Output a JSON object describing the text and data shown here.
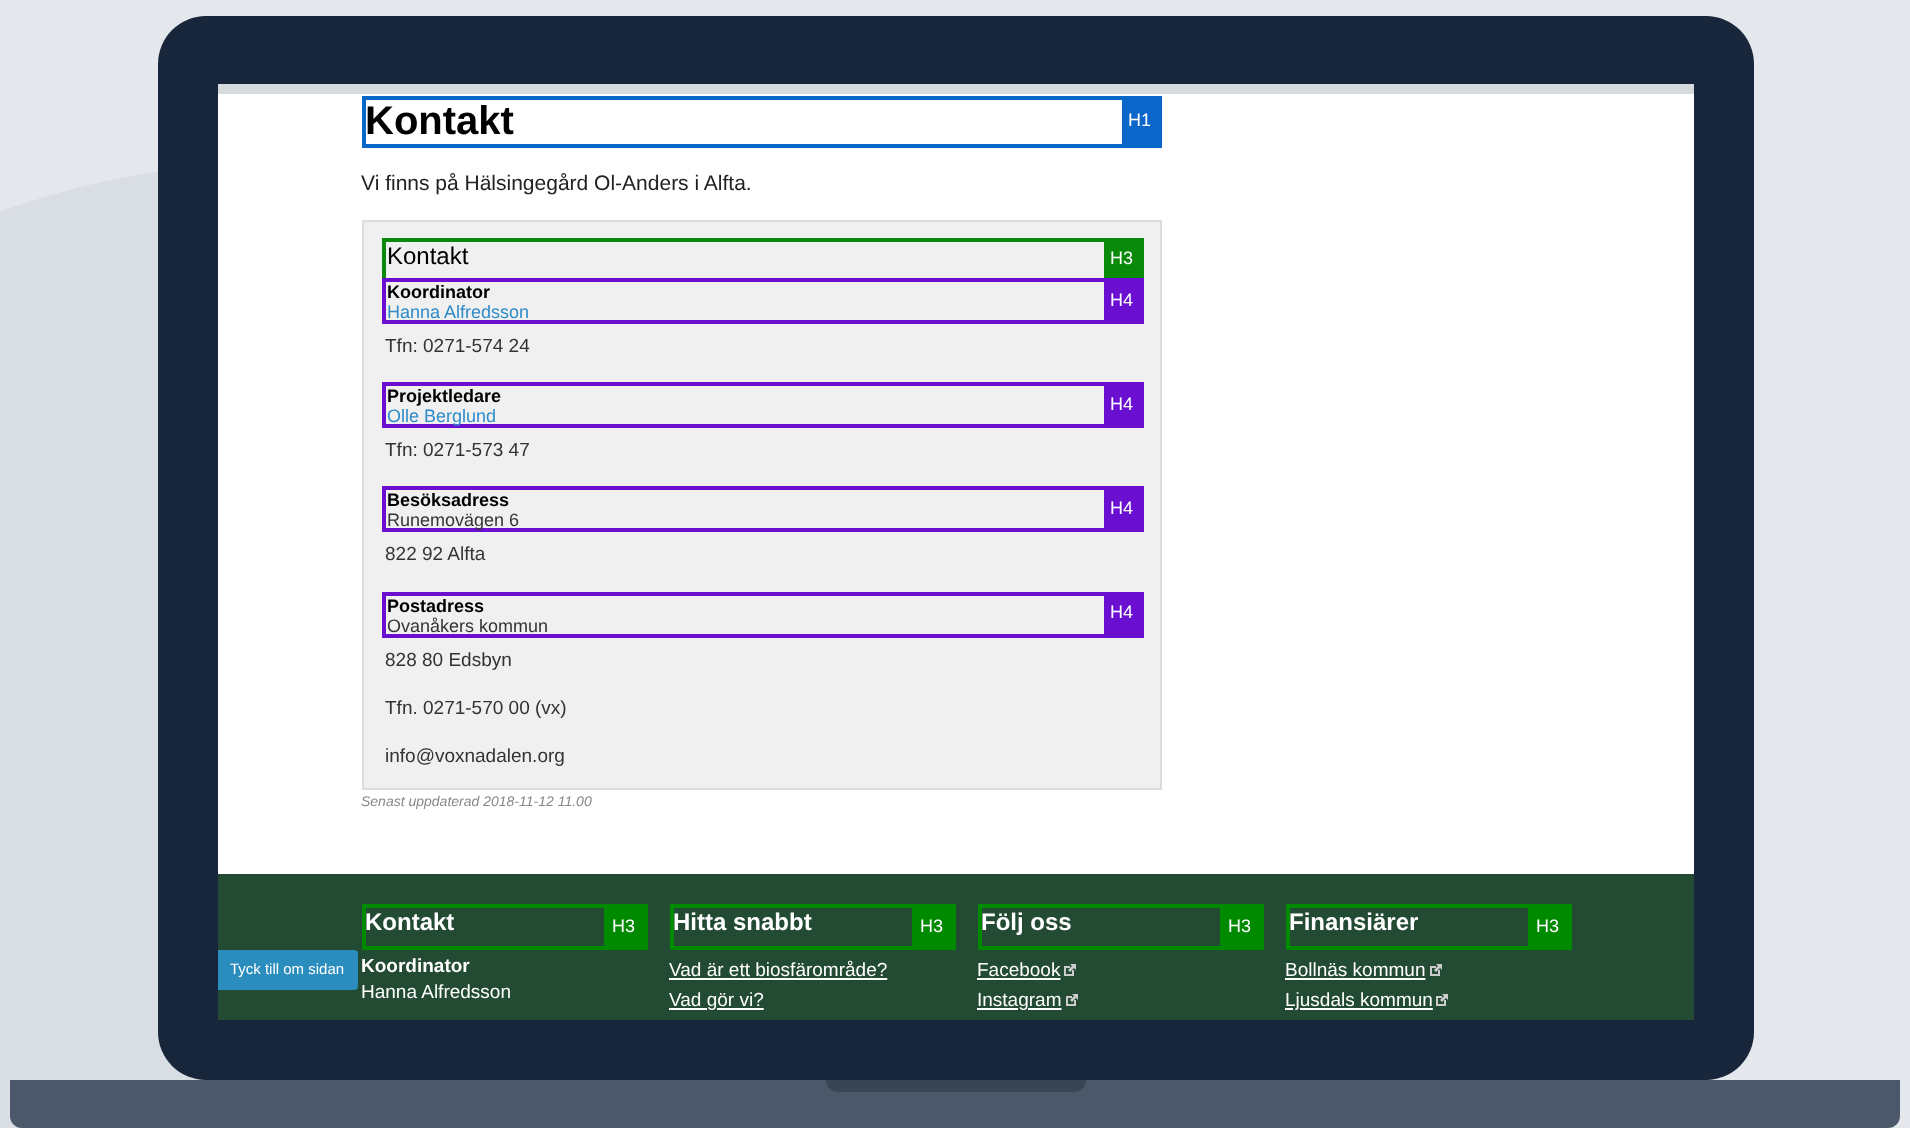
{
  "page_heading": {
    "text": "Kontakt",
    "badge": "H1"
  },
  "intro": "Vi finns på Hälsingegård Ol-Anders i Alfta.",
  "contact_box": {
    "heading": {
      "text": "Kontakt",
      "badge": "H3"
    },
    "sections": [
      {
        "title": "Koordinator",
        "badge": "H4",
        "first_line": {
          "text": "Hanna Alfredsson",
          "link": true
        },
        "lines": [
          "Tfn: 0271-574 24"
        ]
      },
      {
        "title": "Projektledare",
        "badge": "H4",
        "first_line": {
          "text": "Olle Berglund",
          "link": true
        },
        "lines": [
          "Tfn: 0271-573 47"
        ]
      },
      {
        "title": "Besöksadress",
        "badge": "H4",
        "first_line": {
          "text": "Runemovägen 6",
          "link": false
        },
        "lines": [
          "822 92 Alfta"
        ]
      },
      {
        "title": "Postadress",
        "badge": "H4",
        "first_line": {
          "text": "Ovanåkers kommun",
          "link": false
        },
        "lines": [
          "828 80 Edsbyn"
        ]
      }
    ],
    "extra_lines": [
      "Tfn. 0271-570 00 (vx)",
      "info@voxnadalen.org"
    ]
  },
  "updated": "Senast uppdaterad 2018-11-12 11.00",
  "feedback_button": "Tyck till om sidan",
  "footer_columns": [
    {
      "heading": "Kontakt",
      "badge": "H3",
      "items": [
        {
          "text": "Koordinator",
          "kind": "label",
          "external": false
        },
        {
          "text": "Hanna Alfredsson",
          "kind": "text",
          "external": false
        }
      ]
    },
    {
      "heading": "Hitta snabbt",
      "badge": "H3",
      "items": [
        {
          "text": "Vad är ett biosfärområde?",
          "kind": "link",
          "external": false
        },
        {
          "text": "Vad gör vi?",
          "kind": "link",
          "external": false
        }
      ]
    },
    {
      "heading": "Följ oss",
      "badge": "H3",
      "items": [
        {
          "text": "Facebook",
          "kind": "link",
          "external": true
        },
        {
          "text": "Instagram",
          "kind": "link",
          "external": true
        }
      ]
    },
    {
      "heading": "Finansiärer",
      "badge": "H3",
      "items": [
        {
          "text": "Bollnäs kommun",
          "kind": "link",
          "external": true
        },
        {
          "text": "Ljusdals kommun",
          "kind": "link",
          "external": true
        }
      ]
    }
  ]
}
